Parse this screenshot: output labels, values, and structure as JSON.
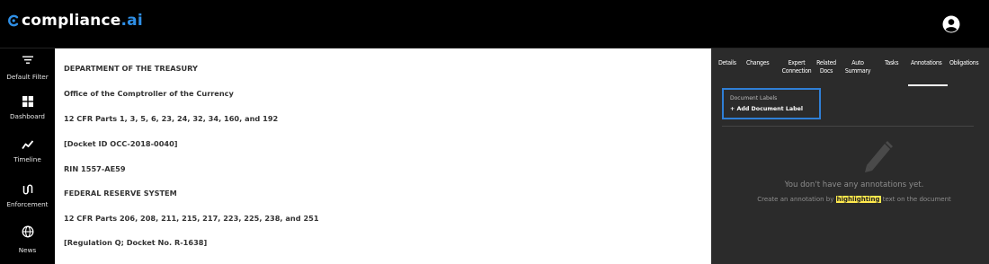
{
  "brand": {
    "name_main": "compliance",
    "name_suffix": ".ai",
    "accent": "#2f8fe6"
  },
  "sidebar": {
    "items": [
      {
        "label": "Default Filter",
        "icon": "filter-icon"
      },
      {
        "label": "Dashboard",
        "icon": "dashboard-icon"
      },
      {
        "label": "Timeline",
        "icon": "timeline-icon"
      },
      {
        "label": "Enforcement",
        "icon": "enforcement-icon"
      },
      {
        "label": "News",
        "icon": "globe-icon"
      }
    ]
  },
  "document": {
    "lines": [
      "DEPARTMENT OF THE TREASURY",
      "Office of the Comptroller of the Currency",
      "12 CFR Parts 1, 3, 5, 6, 23, 24, 32, 34, 160, and 192",
      "[Docket ID OCC-2018-0040]",
      "RIN 1557-AE59",
      "FEDERAL RESERVE SYSTEM",
      "12 CFR Parts 206, 208, 211, 215, 217, 223, 225, 238, and 251",
      "[Regulation Q; Docket No. R-1638]"
    ]
  },
  "panel": {
    "tabs": [
      {
        "line1": "Details",
        "line2": ""
      },
      {
        "line1": "Changes",
        "line2": ""
      },
      {
        "line1": "Expert",
        "line2": "Connection"
      },
      {
        "line1": "Related",
        "line2": "Docs"
      },
      {
        "line1": "Auto",
        "line2": "Summary"
      },
      {
        "line1": "Tasks",
        "line2": ""
      },
      {
        "line1": "Annotations",
        "line2": ""
      },
      {
        "line1": "Obligations",
        "line2": ""
      }
    ],
    "active_tab": "Annotations",
    "document_labels_title": "Document Labels",
    "add_label": "+ Add Document Label",
    "empty_message": "You don't have any annotations yet.",
    "hint_before": "Create an annotation by ",
    "hint_highlight": "highlighting",
    "hint_after": " text on the document",
    "highlight_color": "#ffe94d"
  }
}
